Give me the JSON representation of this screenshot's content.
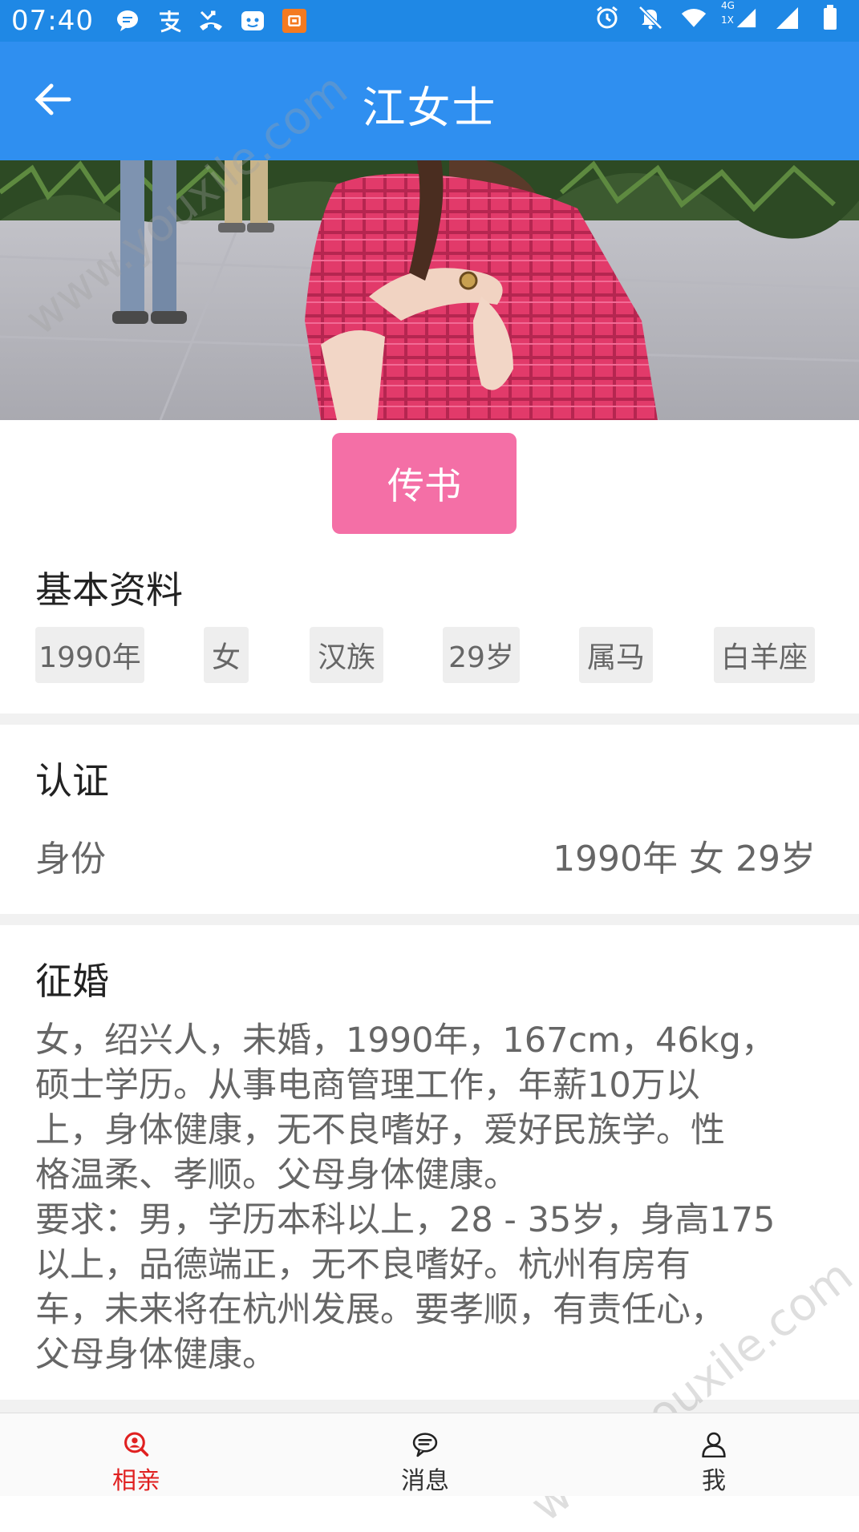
{
  "status_bar": {
    "time": "07:40",
    "left_icons": [
      "message-icon",
      "alipay-icon",
      "missed-call-icon",
      "app-icon",
      "browser-icon"
    ],
    "right_icons": [
      "alarm-icon",
      "mute-icon",
      "wifi-icon",
      "signal-4g-icon",
      "signal-icon",
      "battery-icon"
    ],
    "network_label_top": "4G",
    "network_label_bottom": "1X"
  },
  "header": {
    "title": "江女士",
    "back_icon": "arrow-left-icon"
  },
  "profile": {
    "send_button": "传书"
  },
  "basic_info": {
    "title": "基本资料",
    "tags": [
      "1990年",
      "女",
      "汉族",
      "29岁",
      "属马",
      "白羊座"
    ]
  },
  "verification": {
    "title": "认证",
    "label": "身份",
    "value": "1990年  女  29岁"
  },
  "marriage": {
    "title": "征婚",
    "description": "女，绍兴人，未婚，1990年，167cm，46kg，\n硕士学历。从事电商管理工作，年薪10万以\n上，身体健康，无不良嗜好，爱好民族学。性\n格温柔、孝顺。父母身体健康。\n要求：男，学历本科以上，28 - 35岁，身高175\n以上，品德端正，无不良嗜好。杭州有房有\n车，未来将在杭州发展。要孝顺，有责任心，\n父母身体健康。"
  },
  "tabbar": {
    "tabs": [
      {
        "label": "相亲",
        "icon": "search-person-icon",
        "active": true
      },
      {
        "label": "消息",
        "icon": "chat-bubble-icon",
        "active": false
      },
      {
        "label": "我",
        "icon": "person-icon",
        "active": false
      }
    ]
  },
  "watermarks": [
    "www.youxile.com",
    "www.youxile.com"
  ],
  "colors": {
    "accent": "#2f8ff0",
    "button_pink": "#f46fa6",
    "active_tab": "#e02020"
  }
}
